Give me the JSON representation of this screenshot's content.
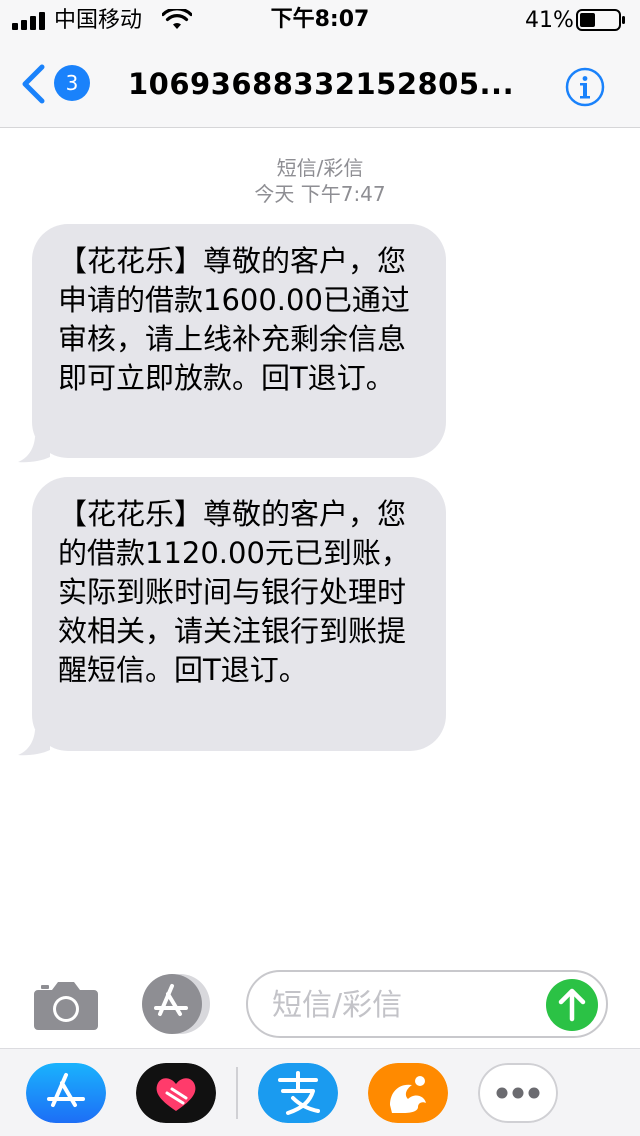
{
  "status_bar": {
    "carrier": "中国移动",
    "time": "下午8:07",
    "battery_percent": "41%",
    "battery_level": 0.41,
    "icons": [
      "signal-icon",
      "wifi-icon",
      "battery-icon"
    ]
  },
  "nav": {
    "back_badge": "3",
    "title": "106936883321528​05...",
    "icons": [
      "chevron-left-icon",
      "info-icon"
    ]
  },
  "conversation": {
    "message_type": "短信/彩信",
    "timestamp": "今天 下午7:47",
    "messages": [
      {
        "text": "【花花乐】尊敬的客户，您申请的借款1600.00已通过审核，请上线补充剩余信息即可立即放款。回T退订。"
      },
      {
        "text": "【花花乐】尊敬的客户，您的借款1120.00元已到账，实际到账时间与银行处理时效相关，请关注银行到账提醒短信。回T退订。"
      }
    ]
  },
  "input_bar": {
    "placeholder": "短信/彩信",
    "value": "",
    "icons": [
      "camera-icon",
      "app-store-icon",
      "send-arrow-icon"
    ]
  },
  "app_drawer": {
    "apps": [
      "app-store-icon",
      "digital-touch-icon",
      "alipay-icon",
      "uc-browser-icon",
      "more-icon"
    ]
  },
  "colors": {
    "accent": "#1a82fb",
    "bubble": "#e5e5ea",
    "send": "#2bc245",
    "meta_text": "#8e8e93"
  }
}
